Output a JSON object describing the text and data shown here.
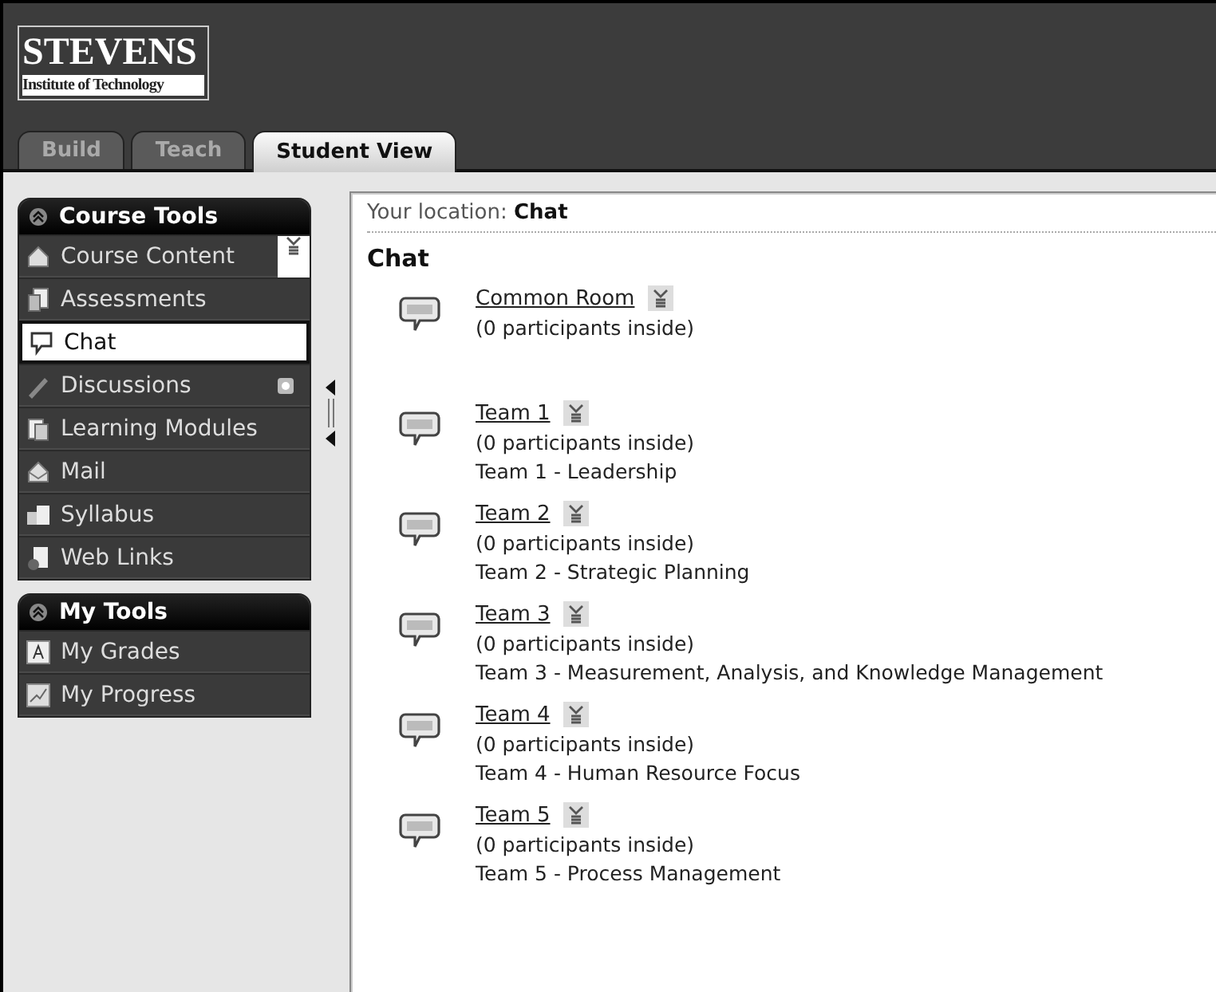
{
  "logo": {
    "name": "STEVENS",
    "subtitle": "Institute of Technology"
  },
  "tabs": [
    {
      "label": "Build",
      "selected": false
    },
    {
      "label": "Teach",
      "selected": false
    },
    {
      "label": "Student View",
      "selected": true
    }
  ],
  "sidebar": [
    {
      "title": "Course Tools",
      "items": [
        {
          "label": "Course Content",
          "selected": false,
          "dropdown": true,
          "badge": false
        },
        {
          "label": "Assessments",
          "selected": false,
          "dropdown": false,
          "badge": false
        },
        {
          "label": "Chat",
          "selected": true,
          "dropdown": false,
          "badge": false
        },
        {
          "label": "Discussions",
          "selected": false,
          "dropdown": false,
          "badge": true
        },
        {
          "label": "Learning Modules",
          "selected": false,
          "dropdown": false,
          "badge": false
        },
        {
          "label": "Mail",
          "selected": false,
          "dropdown": false,
          "badge": false
        },
        {
          "label": "Syllabus",
          "selected": false,
          "dropdown": false,
          "badge": false
        },
        {
          "label": "Web Links",
          "selected": false,
          "dropdown": false,
          "badge": false
        }
      ]
    },
    {
      "title": "My Tools",
      "items": [
        {
          "label": "My Grades",
          "selected": false,
          "dropdown": false,
          "badge": false
        },
        {
          "label": "My Progress",
          "selected": false,
          "dropdown": false,
          "badge": false
        }
      ]
    }
  ],
  "location": {
    "label": "Your location:",
    "value": "Chat"
  },
  "page_title": "Chat",
  "rooms": [
    {
      "name": "Common Room",
      "participants": "(0 participants inside)"
    },
    {
      "name": "Team 1",
      "participants": "(0 participants inside)",
      "description": "Team 1 - Leadership"
    },
    {
      "name": "Team 2",
      "participants": "(0 participants inside)",
      "description": "Team 2 - Strategic Planning"
    },
    {
      "name": "Team 3",
      "participants": "(0 participants inside)",
      "description": "Team 3 - Measurement, Analysis, and Knowledge Management"
    },
    {
      "name": "Team 4",
      "participants": "(0 participants inside)",
      "description": "Team 4 - Human Resource Focus"
    },
    {
      "name": "Team 5",
      "participants": "(0 participants inside)",
      "description": "Team 5 - Process Management"
    }
  ]
}
